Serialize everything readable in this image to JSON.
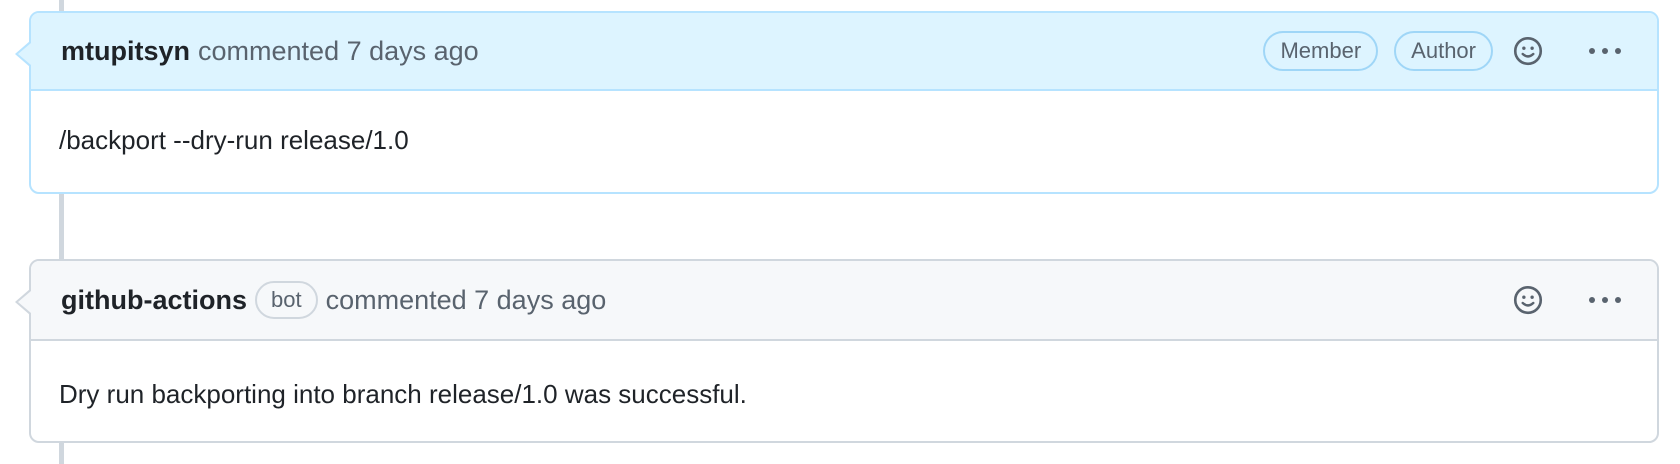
{
  "comments": [
    {
      "author": "mtupitsyn",
      "meta": "commented 7 days ago",
      "badges": [
        "Member",
        "Author"
      ],
      "body": "/backport --dry-run release/1.0"
    },
    {
      "author": "github-actions",
      "bot_label": "bot",
      "meta": "commented 7 days ago",
      "body": "Dry run backporting into branch release/1.0 was successful."
    }
  ],
  "icons": {
    "reaction": "smiley-icon",
    "more": "kebab-horizontal-icon"
  },
  "colors": {
    "highlight_header": "#ddf4ff",
    "highlight_border": "#b6e3ff",
    "default_header": "#f6f8fa",
    "border": "#d0d7de",
    "muted_text": "#59636e"
  }
}
